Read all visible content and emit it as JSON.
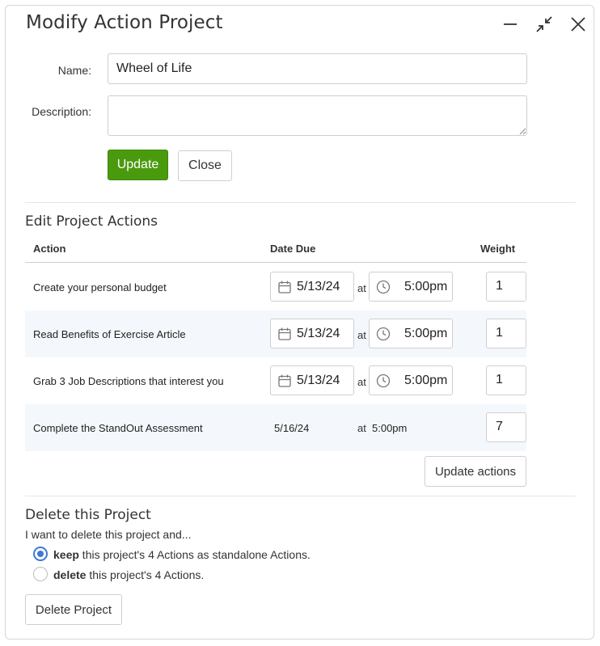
{
  "dialog": {
    "title": "Modify Action Project",
    "controls": [
      "minimize-icon",
      "collapse-icon",
      "close-icon"
    ]
  },
  "form": {
    "name_label": "Name:",
    "name_value": "Wheel of Life",
    "description_label": "Description:",
    "description_value": "",
    "update_label": "Update",
    "close_label": "Close"
  },
  "actions_section": {
    "title": "Edit Project Actions",
    "columns": [
      "Action",
      "Date Due",
      "Weight"
    ],
    "at_label": "at",
    "rows": [
      {
        "action": "Create your personal budget",
        "date": "5/13/24",
        "time": "5:00pm",
        "weight": "1",
        "editable": true
      },
      {
        "action": "Read Benefits of Exercise Article",
        "date": "5/13/24",
        "time": "5:00pm",
        "weight": "1",
        "editable": true
      },
      {
        "action": "Grab 3 Job Descriptions that interest you",
        "date": "5/13/24",
        "time": "5:00pm",
        "weight": "1",
        "editable": true
      },
      {
        "action": "Complete the StandOut Assessment",
        "date": "5/16/24",
        "time": "5:00pm",
        "weight": "7",
        "editable": false
      }
    ],
    "update_actions_label": "Update actions"
  },
  "delete_section": {
    "title": "Delete this Project",
    "intro": "I want to delete this project and...",
    "options": [
      {
        "bold": "keep",
        "rest": " this project's 4 Actions as standalone Actions.",
        "checked": true
      },
      {
        "bold": "delete",
        "rest": " this project's 4 Actions.",
        "checked": false
      }
    ],
    "delete_label": "Delete Project"
  },
  "colors": {
    "primary_button": "#4a9a0e",
    "radio_accent": "#3d78d8",
    "alt_row": "#f4f8fc"
  }
}
